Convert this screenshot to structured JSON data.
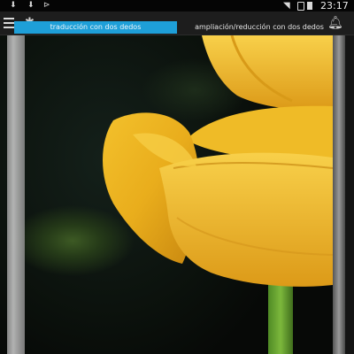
{
  "status_bar": {
    "time": "23:17",
    "icons": [
      "download-icon",
      "download-icon",
      "play-icon",
      "wifi-icon",
      "sim-icon",
      "battery-icon"
    ]
  },
  "toolbar": {
    "tabs": [
      {
        "label": "traducción con dos dedos",
        "active": true
      },
      {
        "label": "ampliación/reducción con dos dedos",
        "active": false
      }
    ],
    "accent_color": "#1e9fd8"
  },
  "viewer": {
    "subject": "yellow tulip photo"
  }
}
